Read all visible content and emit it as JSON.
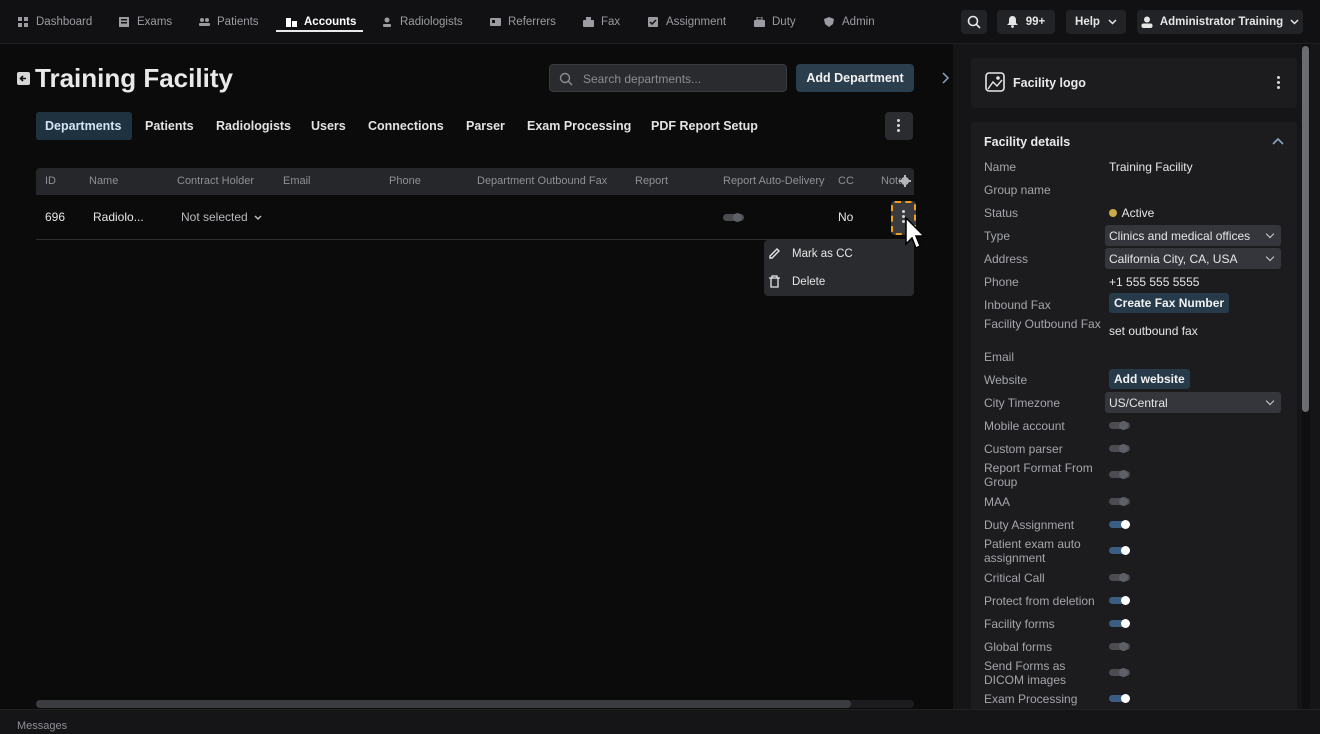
{
  "nav": {
    "items": [
      {
        "label": "Dashboard"
      },
      {
        "label": "Exams"
      },
      {
        "label": "Patients"
      },
      {
        "label": "Accounts"
      },
      {
        "label": "Radiologists"
      },
      {
        "label": "Referrers"
      },
      {
        "label": "Fax"
      },
      {
        "label": "Assignment"
      },
      {
        "label": "Duty"
      },
      {
        "label": "Admin"
      }
    ],
    "active": "Accounts",
    "notifications_badge": "99+",
    "help_label": "Help",
    "user_label": "Administrator Training"
  },
  "page": {
    "title": "Training Facility",
    "search_placeholder": "Search departments...",
    "add_button": "Add Department"
  },
  "tabs": [
    "Departments",
    "Patients",
    "Radiologists",
    "Users",
    "Connections",
    "Parser",
    "Exam Processing",
    "PDF Report Setup"
  ],
  "table": {
    "headers": [
      "ID",
      "Name",
      "Contract Holder",
      "Email",
      "Phone",
      "Department Outbound Fax",
      "Report",
      "Report Auto-Delivery",
      "CC",
      "Notes"
    ],
    "rows": [
      {
        "id": "696",
        "name": "Radiolo...",
        "contract_holder": "Not selected",
        "auto_delivery": false,
        "cc": "No"
      }
    ]
  },
  "row_menu": {
    "items": [
      "Mark as CC",
      "Delete"
    ]
  },
  "panel": {
    "logo_title": "Facility logo",
    "details_title": "Facility details",
    "fields": {
      "name_label": "Name",
      "name_value": "Training Facility",
      "group_label": "Group name",
      "status_label": "Status",
      "status_value": "Active",
      "type_label": "Type",
      "type_value": "Clinics and medical offices",
      "address_label": "Address",
      "address_value": "California City, CA, USA",
      "phone_label": "Phone",
      "phone_value": "+1 555 555 5555",
      "inbound_fax_label": "Inbound Fax",
      "inbound_fax_button": "Create Fax Number",
      "outbound_fax_label": "Facility Outbound Fax",
      "outbound_fax_value": "set outbound fax",
      "email_label": "Email",
      "website_label": "Website",
      "website_button": "Add website",
      "timezone_label": "City Timezone",
      "timezone_value": "US/Central"
    },
    "toggles": [
      {
        "label": "Mobile account",
        "on": false
      },
      {
        "label": "Custom parser",
        "on": false
      },
      {
        "label": "Report Format From Group",
        "on": false
      },
      {
        "label": "MAA",
        "on": false
      },
      {
        "label": "Duty Assignment",
        "on": true
      },
      {
        "label": "Patient exam auto assignment",
        "on": true
      },
      {
        "label": "Critical Call",
        "on": false
      },
      {
        "label": "Protect from deletion",
        "on": true
      },
      {
        "label": "Facility forms",
        "on": true
      },
      {
        "label": "Global forms",
        "on": false
      },
      {
        "label": "Send Forms as DICOM images",
        "on": false
      },
      {
        "label": "Exam Processing",
        "on": true
      }
    ],
    "status_color": "#c9a94a",
    "accent_color": "#3b5d83"
  },
  "footer": {
    "label": "Messages"
  }
}
